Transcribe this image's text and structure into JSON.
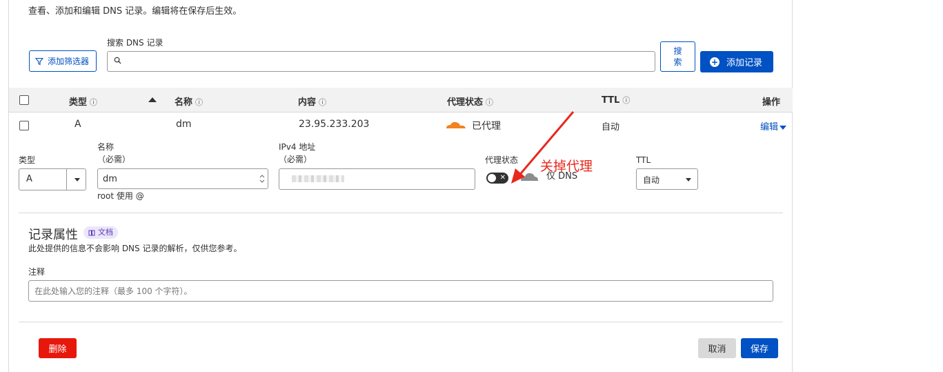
{
  "description": "查看、添加和编辑 DNS 记录。编辑将在保存后生效。",
  "toolbar": {
    "filter_label": "添加筛选器",
    "search_label": "搜索 DNS 记录",
    "search_value": "",
    "search_button": "搜索",
    "add_record_label": "添加记录"
  },
  "table": {
    "headers": {
      "type": "类型",
      "name": "名称",
      "content": "内容",
      "proxy": "代理状态",
      "ttl": "TTL",
      "actions": "操作"
    },
    "info_glyph": "ⓘ",
    "row": {
      "type": "A",
      "name": "dm",
      "content": "23.95.233.203",
      "proxy": "已代理",
      "ttl": "自动",
      "edit": "编辑"
    }
  },
  "edit_form": {
    "type_label": "类型",
    "type_value": "A",
    "name_label": "名称",
    "name_required": "（必需）",
    "name_value": "dm",
    "name_hint": "root 使用 @",
    "ipv4_label": "IPv4 地址",
    "ipv4_required": "（必需）",
    "proxy_label": "代理状态",
    "proxy_toggle_value": "off",
    "proxy_status_text": "仅 DNS",
    "ttl_label": "TTL",
    "ttl_value": "自动"
  },
  "annotation": "关掉代理",
  "record_attributes": {
    "title": "记录属性",
    "doc_badge": "文档",
    "description": "此处提供的信息不会影响 DNS 记录的解析，仅供您参考。",
    "note_label": "注释",
    "note_placeholder": "在此处输入您的注释（最多 100 个字符）。"
  },
  "footer": {
    "delete": "删除",
    "cancel": "取消",
    "save": "保存"
  },
  "colors": {
    "accent": "#0051c3",
    "danger": "#e8170c",
    "proxied_cloud": "#f48120",
    "annotation": "#e8281d"
  }
}
